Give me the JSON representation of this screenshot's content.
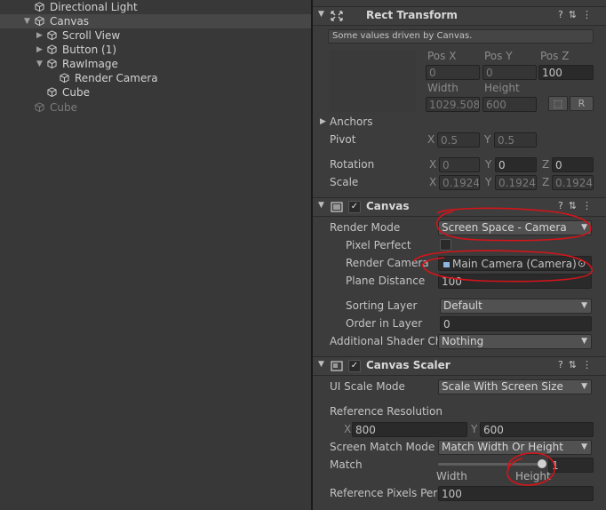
{
  "hierarchy": {
    "items": [
      {
        "label": "Directional Light"
      },
      {
        "label": "Canvas"
      },
      {
        "label": "Scroll View"
      },
      {
        "label": "Button (1)"
      },
      {
        "label": "RawImage"
      },
      {
        "label": "Render Camera"
      },
      {
        "label": "Cube"
      },
      {
        "label": "Cube"
      }
    ]
  },
  "rect_transform": {
    "title": "Rect Transform",
    "note": "Some values driven by Canvas.",
    "pos_x_label": "Pos X",
    "pos_y_label": "Pos Y",
    "pos_z_label": "Pos Z",
    "pos_x": "0",
    "pos_y": "0",
    "pos_z": "100",
    "width_label": "Width",
    "height_label": "Height",
    "width": "1029.508",
    "height": "600",
    "r_button": "R",
    "anchors_label": "Anchors",
    "pivot_label": "Pivot",
    "pivot_x": "0.5",
    "pivot_y": "0.5",
    "rotation_label": "Rotation",
    "rot_x": "0",
    "rot_y": "0",
    "rot_z": "0",
    "scale_label": "Scale",
    "scale_x": "0.19245",
    "scale_y": "0.19245",
    "scale_z": "0.19245",
    "x": "X",
    "y": "Y",
    "z": "Z"
  },
  "canvas": {
    "title": "Canvas",
    "render_mode_label": "Render Mode",
    "render_mode": "Screen Space - Camera",
    "pixel_perfect_label": "Pixel Perfect",
    "render_camera_label": "Render Camera",
    "render_camera": "Main Camera (Camera)",
    "plane_distance_label": "Plane Distance",
    "plane_distance": "100",
    "sorting_layer_label": "Sorting Layer",
    "sorting_layer": "Default",
    "order_in_layer_label": "Order in Layer",
    "order_in_layer": "0",
    "shader_channels_label": "Additional Shader Ch",
    "shader_channels": "Nothing"
  },
  "canvas_scaler": {
    "title": "Canvas Scaler",
    "ui_scale_mode_label": "UI Scale Mode",
    "ui_scale_mode": "Scale With Screen Size",
    "ref_res_label": "Reference Resolution",
    "ref_x": "800",
    "ref_y": "600",
    "screen_match_label": "Screen Match Mode",
    "screen_match": "Match Width Or Height",
    "match_label": "Match",
    "match_value": "1",
    "match_fraction": 1.0,
    "width_caption": "Width",
    "height_caption": "Height",
    "ref_pixels_label": "Reference Pixels Per",
    "ref_pixels": "100"
  },
  "colors": {
    "annotation": "#d4141a",
    "selected_row": "#474747",
    "panel": "#3c3c3c"
  }
}
